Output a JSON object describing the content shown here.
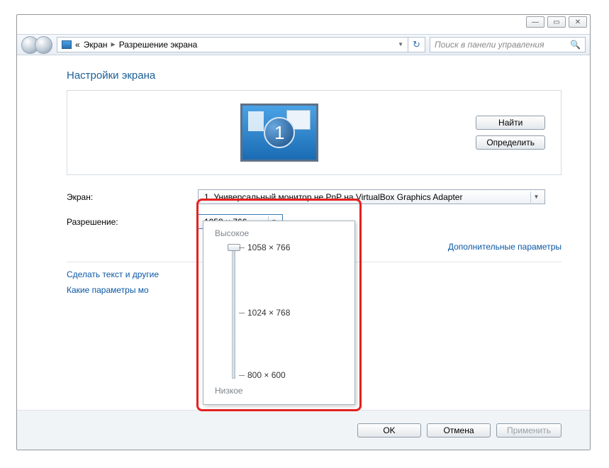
{
  "breadcrumb": {
    "pre": "«",
    "item1": "Экран",
    "item2": "Разрешение экрана"
  },
  "search": {
    "placeholder": "Поиск в панели управления"
  },
  "heading": "Настройки экрана",
  "monitor_number": "1",
  "buttons": {
    "find": "Найти",
    "identify": "Определить",
    "ok": "OK",
    "cancel": "Отмена",
    "apply": "Применить"
  },
  "labels": {
    "display": "Экран:",
    "resolution": "Разрешение:"
  },
  "display_selected": "1. Универсальный монитор не PnP на VirtualBox Graphics Adapter",
  "resolution_selected": "1058 × 766",
  "links": {
    "advanced": "Дополнительные параметры",
    "text_size": "Сделать текст и другие",
    "which_params": "Какие параметры мо"
  },
  "popup": {
    "high": "Высокое",
    "low": "Низкое",
    "options": [
      "1058 × 766",
      "1024 × 768",
      "800 × 600"
    ]
  }
}
